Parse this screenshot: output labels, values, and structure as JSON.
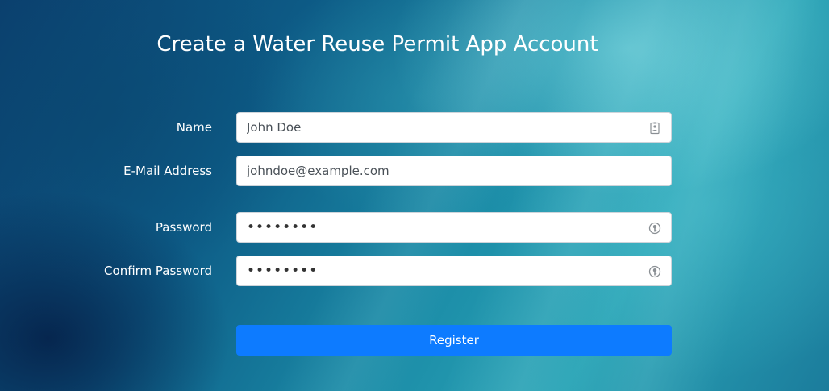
{
  "page": {
    "title": "Create a Water Reuse Permit App Account"
  },
  "form": {
    "name": {
      "label": "Name",
      "value": "John Doe",
      "icon": "contact-card-icon"
    },
    "email": {
      "label": "E-Mail Address",
      "value": "johndoe@example.com"
    },
    "password": {
      "label": "Password",
      "value": "••••••••",
      "icon": "key-icon"
    },
    "confirm_password": {
      "label": "Confirm Password",
      "value": "••••••••",
      "icon": "key-icon"
    },
    "register_label": "Register"
  },
  "colors": {
    "button": "#0d7bff",
    "text_on_background": "#ffffff",
    "input_text": "#495057"
  }
}
